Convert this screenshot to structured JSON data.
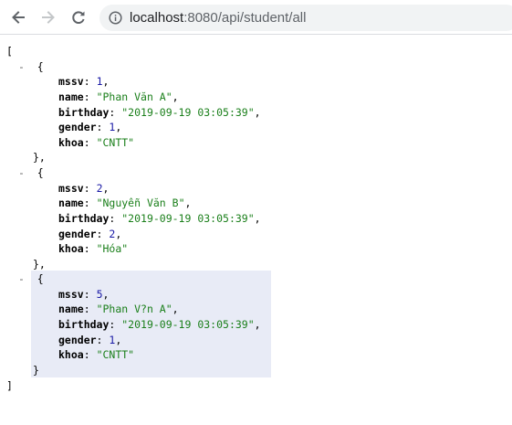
{
  "browser": {
    "url_host": "localhost",
    "url_rest": ":8080/api/student/all"
  },
  "icons": {
    "back": "back-arrow-icon",
    "forward": "forward-arrow-icon",
    "reload": "reload-icon",
    "info": "info-icon"
  },
  "json": {
    "open_array": "[",
    "close_array": "]",
    "toggle": "-",
    "open_obj": "{",
    "close_obj": "},",
    "close_obj_last": "}",
    "keys": {
      "mssv": "mssv",
      "name": "name",
      "birthday": "birthday",
      "gender": "gender",
      "khoa": "khoa"
    },
    "records": [
      {
        "mssv": "1",
        "name": "\"Phan Văn A\"",
        "birthday": "\"2019-09-19 03:05:39\"",
        "gender": "1",
        "khoa": "\"CNTT\""
      },
      {
        "mssv": "2",
        "name": "\"Nguyễn Văn B\"",
        "birthday": "\"2019-09-19 03:05:39\"",
        "gender": "2",
        "khoa": "\"Hóa\""
      },
      {
        "mssv": "5",
        "name": "\"Phan V?n A\"",
        "birthday": "\"2019-09-19 03:05:39\"",
        "gender": "1",
        "khoa": "\"CNTT\""
      }
    ]
  },
  "colors": {
    "key": "#000000",
    "number": "#1a1aa6",
    "string": "#1a7f1a",
    "highlight": "#e8ebf6"
  }
}
